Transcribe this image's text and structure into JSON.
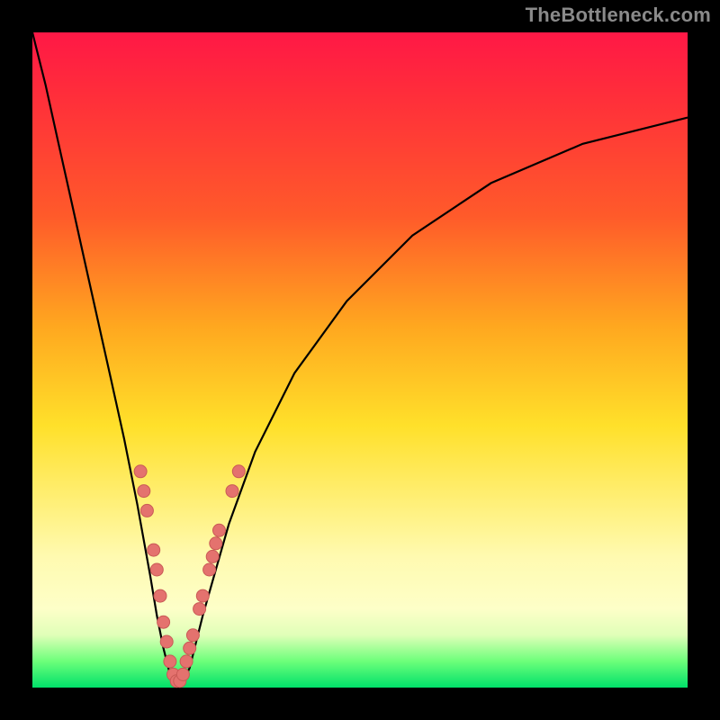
{
  "watermark": "TheBottleneck.com",
  "colors": {
    "curve_stroke": "#000000",
    "marker_fill": "#e4726e",
    "marker_stroke": "#c95a56"
  },
  "chart_data": {
    "type": "line",
    "title": "",
    "xlabel": "",
    "ylabel": "",
    "xlim": [
      0,
      100
    ],
    "ylim": [
      0,
      100
    ],
    "series": [
      {
        "name": "bottleneck-curve",
        "x": [
          0,
          2,
          4,
          6,
          8,
          10,
          12,
          14,
          16,
          18,
          19,
          20,
          21,
          22,
          23,
          24,
          25,
          26,
          28,
          30,
          34,
          40,
          48,
          58,
          70,
          84,
          100
        ],
        "y": [
          100,
          92,
          83,
          74,
          65,
          56,
          47,
          38,
          28,
          17,
          11,
          6,
          2,
          0,
          1,
          3,
          7,
          11,
          18,
          25,
          36,
          48,
          59,
          69,
          77,
          83,
          87
        ]
      }
    ],
    "markers": [
      {
        "x": 16.5,
        "y": 33
      },
      {
        "x": 17.0,
        "y": 30
      },
      {
        "x": 17.5,
        "y": 27
      },
      {
        "x": 18.5,
        "y": 21
      },
      {
        "x": 19.0,
        "y": 18
      },
      {
        "x": 19.5,
        "y": 14
      },
      {
        "x": 20.0,
        "y": 10
      },
      {
        "x": 20.5,
        "y": 7
      },
      {
        "x": 21.0,
        "y": 4
      },
      {
        "x": 21.5,
        "y": 2
      },
      {
        "x": 22.0,
        "y": 1
      },
      {
        "x": 22.5,
        "y": 1
      },
      {
        "x": 23.0,
        "y": 2
      },
      {
        "x": 23.5,
        "y": 4
      },
      {
        "x": 24.0,
        "y": 6
      },
      {
        "x": 24.5,
        "y": 8
      },
      {
        "x": 25.5,
        "y": 12
      },
      {
        "x": 26.0,
        "y": 14
      },
      {
        "x": 27.0,
        "y": 18
      },
      {
        "x": 27.5,
        "y": 20
      },
      {
        "x": 28.0,
        "y": 22
      },
      {
        "x": 28.5,
        "y": 24
      },
      {
        "x": 30.5,
        "y": 30
      },
      {
        "x": 31.5,
        "y": 33
      }
    ]
  }
}
